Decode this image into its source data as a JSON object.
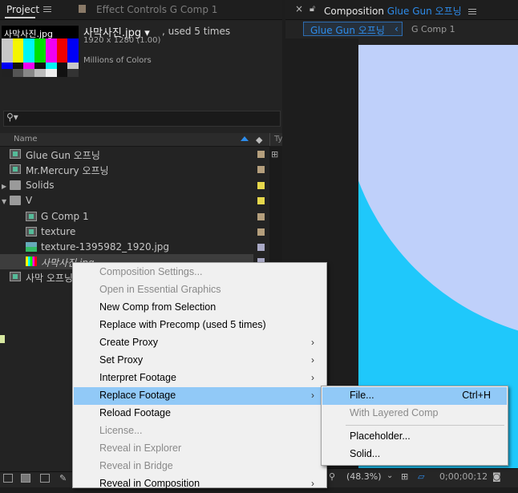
{
  "project_panel": {
    "tab_label": "Project",
    "effect_controls_label": "Effect Controls G Comp 1",
    "asset": {
      "thumb_label": "사막사진.jpg",
      "name": "사막사진.jpg ▾",
      "used": ", used 5 times",
      "dimensions": "1920 x 1280 (1.00)",
      "colors": "Millions of Colors"
    },
    "search_icon": "search-icon",
    "column_name": "Name",
    "column_type": "Ty",
    "items": [
      {
        "label": "Glue Gun 오프닝",
        "type": "comp",
        "color": "#b59f7d"
      },
      {
        "label": "Mr.Mercury 오프닝",
        "type": "comp",
        "color": "#b59f7d"
      },
      {
        "label": "Solids",
        "type": "folder",
        "color": "#e7d84c"
      },
      {
        "label": "V",
        "type": "folder",
        "color": "#e7d84c"
      },
      {
        "label": "G Comp 1",
        "type": "comp",
        "color": "#b59f7d"
      },
      {
        "label": "texture",
        "type": "comp",
        "color": "#b59f7d"
      },
      {
        "label": "texture-1395982_1920.jpg",
        "type": "image",
        "color": "#a9a9c6"
      },
      {
        "label": "사막사진.jpg",
        "type": "image",
        "color": "#a9a9c6"
      },
      {
        "label": "사막 오프닝",
        "type": "comp",
        "color": "#b59f7d"
      }
    ]
  },
  "composition_panel": {
    "tab_prefix": "Composition",
    "tab_comp": "Glue Gun 오프닝",
    "crumb_active": "Glue Gun 오프닝",
    "crumb_next": "G Comp 1",
    "zoom": "(48.3%)",
    "timecode": "0;00;00;12"
  },
  "context_menu": {
    "items": [
      {
        "label": "Composition Settings...",
        "enabled": false,
        "submenu": false
      },
      {
        "label": "Open in Essential Graphics",
        "enabled": false,
        "submenu": false
      },
      {
        "label": "New Comp from Selection",
        "enabled": true,
        "submenu": false
      },
      {
        "label": "Replace with Precomp (used 5 times)",
        "enabled": true,
        "submenu": false
      },
      {
        "label": "Create Proxy",
        "enabled": true,
        "submenu": true
      },
      {
        "label": "Set Proxy",
        "enabled": true,
        "submenu": true
      },
      {
        "label": "Interpret Footage",
        "enabled": true,
        "submenu": true
      },
      {
        "label": "Replace Footage",
        "enabled": true,
        "submenu": true,
        "highlighted": true
      },
      {
        "label": "Reload Footage",
        "enabled": true,
        "submenu": false
      },
      {
        "label": "License...",
        "enabled": false,
        "submenu": false
      },
      {
        "label": "Reveal in Explorer",
        "enabled": false,
        "submenu": false
      },
      {
        "label": "Reveal in Bridge",
        "enabled": false,
        "submenu": false
      },
      {
        "label": "Reveal in Composition",
        "enabled": true,
        "submenu": true
      }
    ],
    "submenu_arrow": "›"
  },
  "replace_submenu": {
    "file_label": "File...",
    "file_shortcut": "Ctrl+H",
    "layered_label": "With Layered Comp",
    "placeholder_label": "Placeholder...",
    "solid_label": "Solid..."
  }
}
